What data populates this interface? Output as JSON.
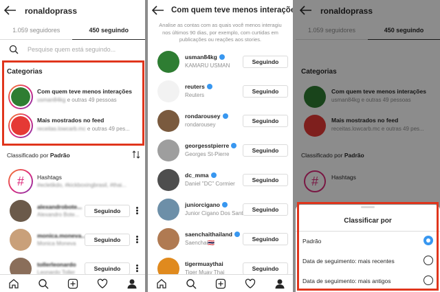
{
  "panel1": {
    "title": "ronaldoprass",
    "tabs": [
      "1.059 seguidores",
      "450 seguindo"
    ],
    "search_placeholder": "Pesquise quem está seguindo...",
    "section_title": "Categorias",
    "categories": [
      {
        "title": "Com quem teve menos interações",
        "sub": "usman84kg e outras 49 pessoas"
      },
      {
        "title": "Mais mostrados no feed",
        "sub": "receitas.lowcarb.mc e outras 49 pes..."
      }
    ],
    "sort_label": "Classificado por",
    "sort_value": "Padrão",
    "hashtags": {
      "title": "Hashtags",
      "sub": "#ecletikdo, #kickboxingbrasil, #thai..."
    },
    "rows": [
      {
        "user": "alexandrobote...",
        "name": "Alexandro Bote...",
        "button": "Seguindo"
      },
      {
        "user": "monica.moneva...",
        "name": "Monica Moneva",
        "button": "Seguindo"
      },
      {
        "user": "tollerleonardo",
        "name": "Leonardo Toller",
        "button": "Seguindo"
      }
    ]
  },
  "panel2": {
    "title": "Com quem teve menos interações",
    "description": "Analise as contas com as quais você menos interagiu nos últimos 90 dias, por exemplo, com curtidas em publicações ou reações aos stories.",
    "button_label": "Seguindo",
    "rows": [
      {
        "user": "usman84kg",
        "name": "KAMARU USMAN",
        "verified": true,
        "avatar_color": "#2e7d32"
      },
      {
        "user": "reuters",
        "name": "Reuters",
        "verified": true,
        "avatar_color": "#f2f2f2"
      },
      {
        "user": "rondarousey",
        "name": "rondarousey",
        "verified": true,
        "avatar_color": "#7a5a3e"
      },
      {
        "user": "georgesstpierre",
        "name": "Georges St-Pierre",
        "verified": true,
        "avatar_color": "#9e9e9e"
      },
      {
        "user": "dc_mma",
        "name": "Daniel \"DC\" Cormier",
        "verified": true,
        "avatar_color": "#4e4e4e"
      },
      {
        "user": "juniorcigano",
        "name": "Junior Cigano Dos Santos",
        "verified": true,
        "avatar_color": "#6d8fa8"
      },
      {
        "user": "saenchaithailand",
        "name": "Saenchai🇹🇭",
        "verified": true,
        "avatar_color": "#b07a52"
      },
      {
        "user": "tigermuaythai",
        "name": "Tiger Muay Thai",
        "verified": false,
        "avatar_color": "#e08a1e"
      }
    ]
  },
  "panel3": {
    "title": "ronaldoprass",
    "tabs": [
      "1.059 seguidores",
      "450 seguindo"
    ],
    "section_title": "Categorias",
    "categories": [
      {
        "title": "Com quem teve menos interações",
        "sub": "usman84kg e outras 49 pessoas"
      },
      {
        "title": "Mais mostrados no feed",
        "sub": "receitas.lowcarb.mc e outras 49 pes..."
      }
    ],
    "sort_label": "Classificado por",
    "sort_value": "Padrão",
    "hashtags_title": "Hashtags",
    "button_label": "Seguindo",
    "sheet": {
      "title": "Classificar por",
      "options": [
        {
          "label": "Padrão",
          "selected": true
        },
        {
          "label": "Data de seguimento: mais recentes",
          "selected": false
        },
        {
          "label": "Data de seguimento: mais antigos",
          "selected": false
        }
      ]
    }
  },
  "icons": [
    "back-arrow-icon",
    "search-icon",
    "sort-icon",
    "home-icon",
    "search-nav-icon",
    "add-icon",
    "heart-icon",
    "profile-icon"
  ],
  "colors": {
    "highlight": "#e0351c",
    "verified": "#3897f0",
    "text": "#262626",
    "muted": "#8e8e8e"
  }
}
